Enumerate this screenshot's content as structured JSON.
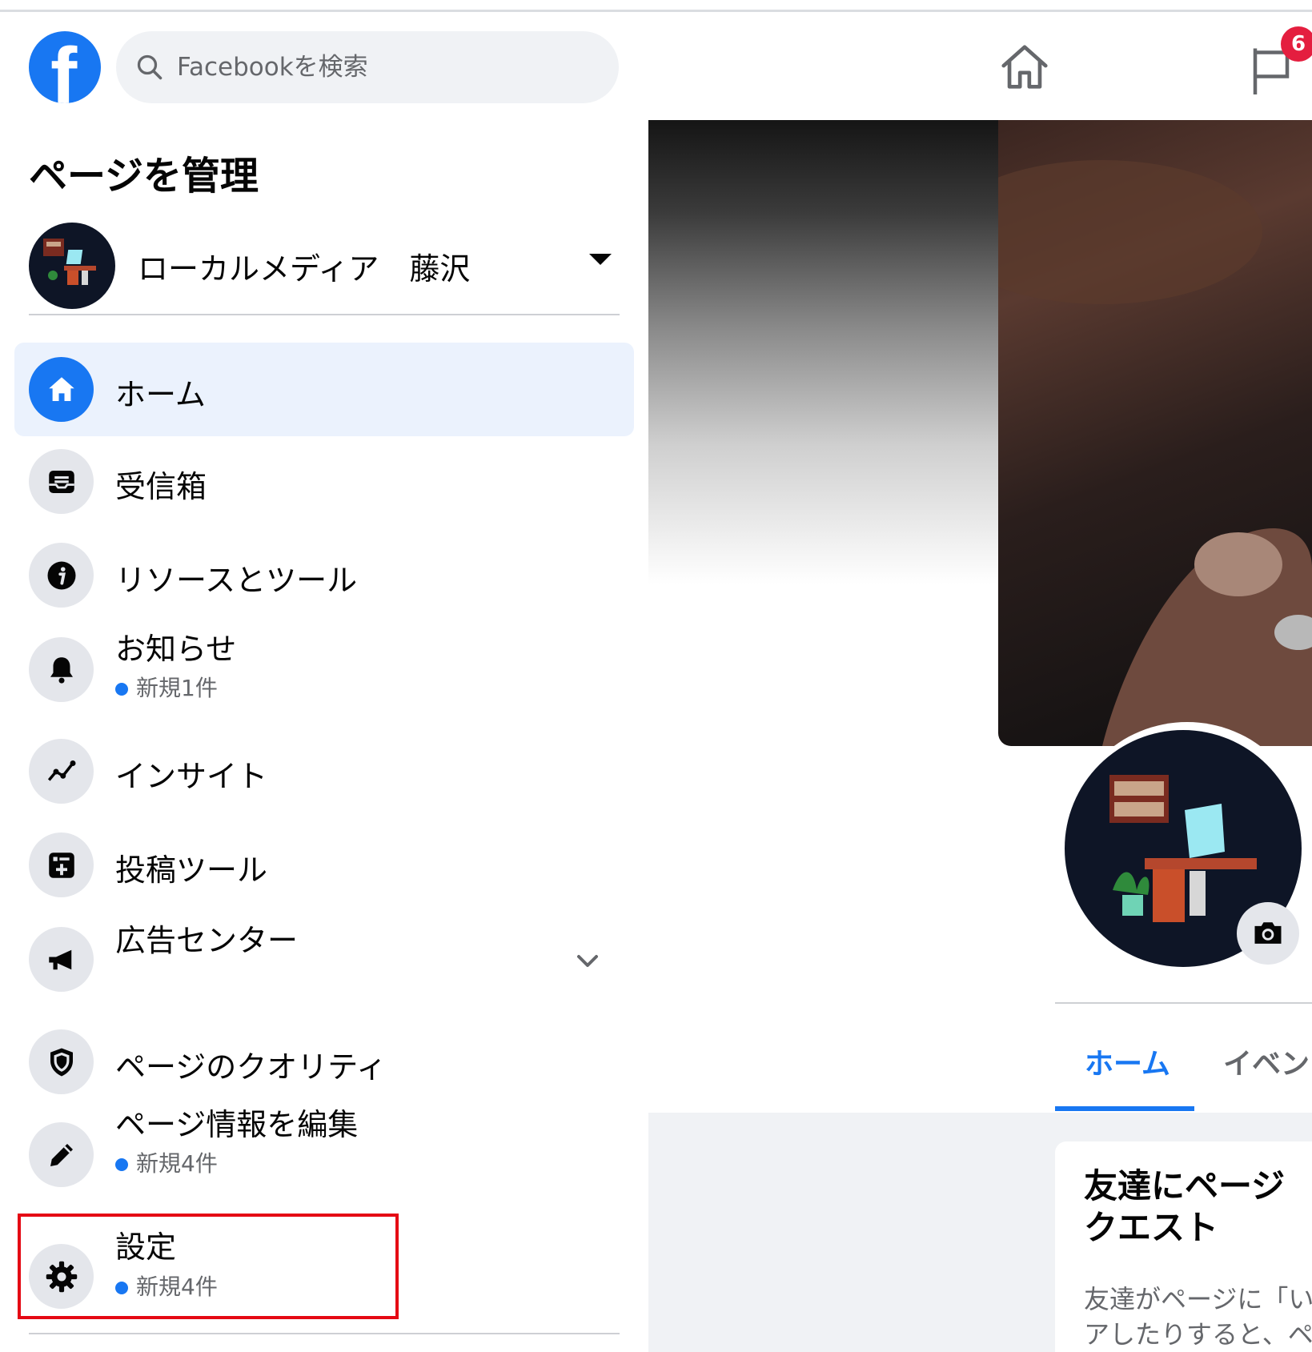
{
  "header": {
    "search_placeholder": "Facebookを検索",
    "notification_count": "6"
  },
  "sidebar": {
    "title": "ページを管理",
    "page_name": "ローカルメディア　藤沢",
    "items": [
      {
        "label": "ホーム",
        "icon": "home-icon",
        "active": true
      },
      {
        "label": "受信箱",
        "icon": "inbox-icon"
      },
      {
        "label": "リソースとツール",
        "icon": "info-icon"
      },
      {
        "label": "お知らせ",
        "icon": "bell-icon",
        "sub": "新規1件"
      },
      {
        "label": "インサイト",
        "icon": "insights-icon"
      },
      {
        "label": "投稿ツール",
        "icon": "publishing-tools-icon"
      },
      {
        "label": "広告センター",
        "icon": "megaphone-icon",
        "expandable": true
      },
      {
        "label": "ページのクオリティ",
        "icon": "shield-icon"
      },
      {
        "label": "ページ情報を編集",
        "icon": "pencil-icon",
        "sub": "新規4件"
      },
      {
        "label": "設定",
        "icon": "gear-icon",
        "sub": "新規4件",
        "highlighted": true
      }
    ]
  },
  "main": {
    "tabs": [
      "ホーム",
      "イベン"
    ],
    "card": {
      "title": "友達にページ",
      "title_line2": "クエスト",
      "body": "友達がページに「い\nアしたりすると、ペ"
    }
  },
  "colors": {
    "brand": "#1877f2",
    "badge": "#e41e3f",
    "highlight_box": "#e50914"
  }
}
